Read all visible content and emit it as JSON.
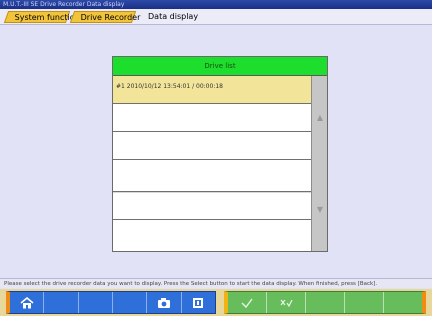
{
  "window": {
    "title": "M.U.T.-III SE  Drive Recorder  Data display"
  },
  "breadcrumb": {
    "items": [
      {
        "label": "System function"
      },
      {
        "label": "Drive Recorder"
      },
      {
        "label": "Data display"
      }
    ]
  },
  "list": {
    "header": "Drive list",
    "rows": [
      {
        "text": "#1  2010/10/12  13:54:01 / 00:00:18",
        "selected": true
      },
      {
        "text": "",
        "selected": false
      },
      {
        "text": "",
        "selected": false
      },
      {
        "text": "",
        "selected": false
      },
      {
        "text": "",
        "selected": false
      },
      {
        "text": "",
        "selected": false
      }
    ],
    "scroll_up": "▲",
    "scroll_down": "▼"
  },
  "statusbar": {
    "text": "Please select the drive recorder data you want to display. Press the Select button to start the data display. When finished, press [Back]."
  },
  "toolbar": {
    "icons": [
      "home-icon",
      "camera-icon",
      "help-icon",
      "check-icon",
      "ok-icon"
    ],
    "colors": {
      "primary": "#2f6fd9",
      "secondary": "#67bc5c",
      "accent": "#f08c14"
    }
  }
}
